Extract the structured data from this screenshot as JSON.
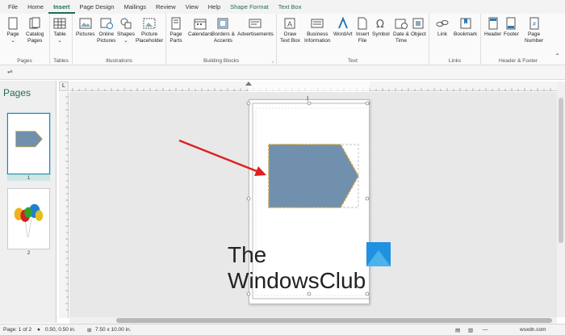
{
  "tabs": [
    {
      "label": "File",
      "active": false,
      "context": false
    },
    {
      "label": "Home",
      "active": false,
      "context": false
    },
    {
      "label": "Insert",
      "active": true,
      "context": false
    },
    {
      "label": "Page Design",
      "active": false,
      "context": false
    },
    {
      "label": "Mailings",
      "active": false,
      "context": false
    },
    {
      "label": "Review",
      "active": false,
      "context": false
    },
    {
      "label": "View",
      "active": false,
      "context": false
    },
    {
      "label": "Help",
      "active": false,
      "context": false
    },
    {
      "label": "Shape Format",
      "active": false,
      "context": true
    },
    {
      "label": "Text Box",
      "active": false,
      "context": true
    }
  ],
  "ribbon": {
    "groups": {
      "pages": "Pages",
      "tables": "Tables",
      "illustrations": "Illustrations",
      "building_blocks": "Building Blocks",
      "text": "Text",
      "links": "Links",
      "header_footer": "Header & Footer"
    },
    "commands": {
      "page": "Page",
      "catalog_pages_1": "Catalog",
      "catalog_pages_2": "Pages",
      "table": "Table",
      "pictures": "Pictures",
      "online_pictures_1": "Online",
      "online_pictures_2": "Pictures",
      "shapes": "Shapes",
      "picture_placeholder_1": "Picture",
      "picture_placeholder_2": "Placeholder",
      "page_parts_1": "Page",
      "page_parts_2": "Parts",
      "calendars": "Calendars",
      "borders_1": "Borders &",
      "borders_2": "Accents",
      "advertisements": "Advertisements",
      "draw_text_box_1": "Draw",
      "draw_text_box_2": "Text Box",
      "business_info_1": "Business",
      "business_info_2": "Information",
      "wordart": "WordArt",
      "insert_file_1": "Insert",
      "insert_file_2": "File",
      "symbol": "Symbol",
      "date_time_1": "Date &",
      "date_time_2": "Time",
      "object": "Object",
      "link": "Link",
      "bookmark": "Bookmark",
      "header": "Header",
      "footer": "Footer",
      "page_number_1": "Page",
      "page_number_2": "Number"
    }
  },
  "pages_pane": {
    "title": "Pages",
    "pages": [
      {
        "number": "1"
      },
      {
        "number": "2"
      }
    ]
  },
  "status": {
    "page": "Page: 1 of 2",
    "position": "0.50, 0.50 in.",
    "size": "7.50 x 10.00 in."
  },
  "watermark": {
    "line1": "The",
    "line2": "WindowsClub"
  },
  "site": "wsxdn.com",
  "colors": {
    "accent": "#1e6e50",
    "shape_fill": "#7090ae",
    "shape_border": "#c8a040",
    "arrow": "#e02020"
  }
}
